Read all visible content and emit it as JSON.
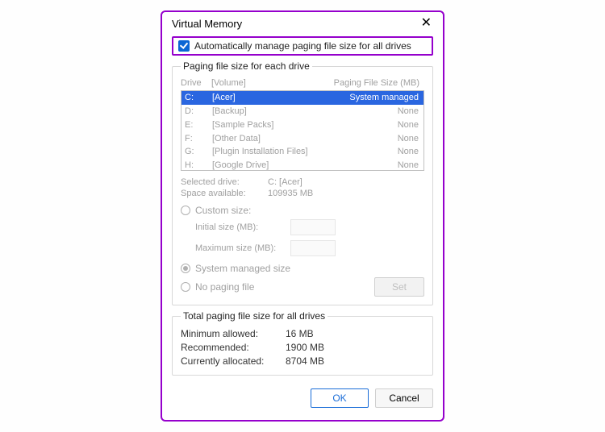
{
  "window": {
    "title": "Virtual Memory",
    "close_icon": "✕"
  },
  "auto_manage": {
    "checked": true,
    "label": "Automatically manage paging file size for all drives"
  },
  "per_drive": {
    "legend": "Paging file size for each drive",
    "header_col1": "Drive",
    "header_col2": "[Volume]",
    "header_col3": "Paging File Size (MB)",
    "drives": [
      {
        "letter": "C:",
        "volume": "[Acer]",
        "size": "System managed",
        "selected": true
      },
      {
        "letter": "D:",
        "volume": "[Backup]",
        "size": "None",
        "selected": false
      },
      {
        "letter": "E:",
        "volume": "[Sample Packs]",
        "size": "None",
        "selected": false
      },
      {
        "letter": "F:",
        "volume": "[Other Data]",
        "size": "None",
        "selected": false
      },
      {
        "letter": "G:",
        "volume": "[Plugin Installation Files]",
        "size": "None",
        "selected": false
      },
      {
        "letter": "H:",
        "volume": "[Google Drive]",
        "size": "None",
        "selected": false
      }
    ],
    "selected_drive_label": "Selected drive:",
    "selected_drive_value": "C:  [Acer]",
    "space_available_label": "Space available:",
    "space_available_value": "109935 MB",
    "custom_size_label": "Custom size:",
    "initial_size_label": "Initial size (MB):",
    "maximum_size_label": "Maximum size (MB):",
    "system_managed_label": "System managed size",
    "no_paging_label": "No paging file",
    "set_button": "Set"
  },
  "totals": {
    "legend": "Total paging file size for all drives",
    "min_label": "Minimum allowed:",
    "min_value": "16 MB",
    "rec_label": "Recommended:",
    "rec_value": "1900 MB",
    "cur_label": "Currently allocated:",
    "cur_value": "8704 MB"
  },
  "buttons": {
    "ok": "OK",
    "cancel": "Cancel"
  }
}
